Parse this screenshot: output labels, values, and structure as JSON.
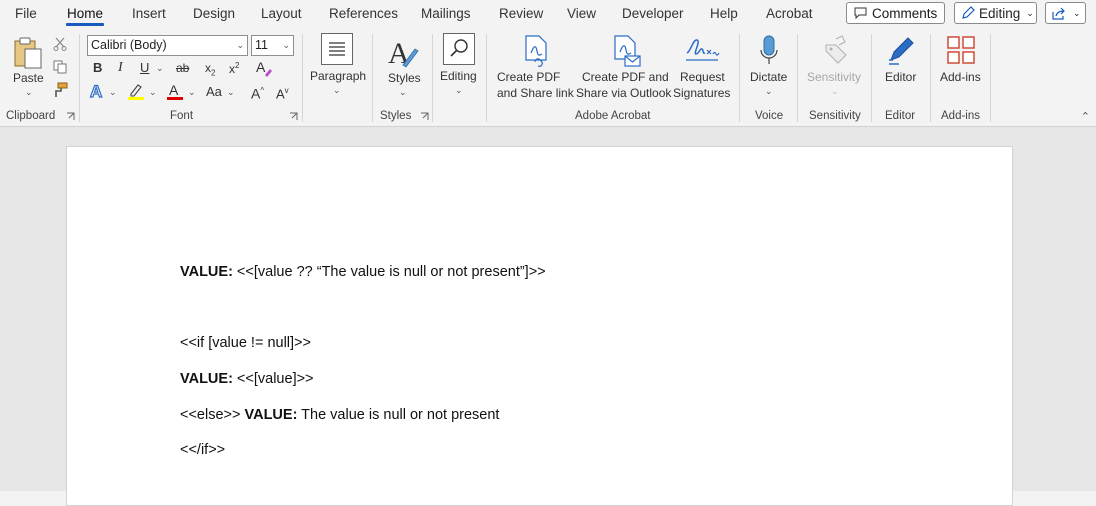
{
  "menu": {
    "tabs": [
      "File",
      "Home",
      "Insert",
      "Design",
      "Layout",
      "References",
      "Mailings",
      "Review",
      "View",
      "Developer",
      "Help",
      "Acrobat"
    ],
    "active": "Home",
    "comments_label": "Comments",
    "editing_label": "Editing"
  },
  "ribbon": {
    "clipboard": {
      "paste": "Paste",
      "group": "Clipboard"
    },
    "font": {
      "name": "Calibri (Body)",
      "size": "11",
      "group": "Font",
      "change_case": "Aa"
    },
    "paragraph": {
      "label": "Paragraph"
    },
    "styles": {
      "label": "Styles",
      "group": "Styles"
    },
    "editing": {
      "label": "Editing"
    },
    "acrobat": {
      "create_pdf_line1": "Create PDF",
      "create_pdf_line2": "and Share link",
      "outlook_line1": "Create PDF and",
      "outlook_line2": "Share via Outlook",
      "request_line1": "Request",
      "request_line2": "Signatures",
      "group": "Adobe Acrobat"
    },
    "voice": {
      "label": "Dictate",
      "group": "Voice"
    },
    "sensitivity": {
      "label": "Sensitivity",
      "group": "Sensitivity"
    },
    "editor": {
      "label": "Editor",
      "group": "Editor"
    },
    "addins": {
      "label": "Add-ins",
      "group": "Add-ins"
    }
  },
  "colors": {
    "accent": "#185abd",
    "highlight": "#ffff00",
    "font_color": "#e00000",
    "addins": "#d04a3a"
  },
  "document": {
    "line1_bold": "VALUE:",
    "line1_text": " <<[value ?? “The value is null or not present”]>>",
    "line2_text": "<<if [value != null]>>",
    "line3_bold": "VALUE:",
    "line3_text": " <<[value]>>",
    "line4_pre": "<<else>> ",
    "line4_bold": "VALUE:",
    "line4_text": " The value is null or not present",
    "line5_text": "<</if>>"
  }
}
